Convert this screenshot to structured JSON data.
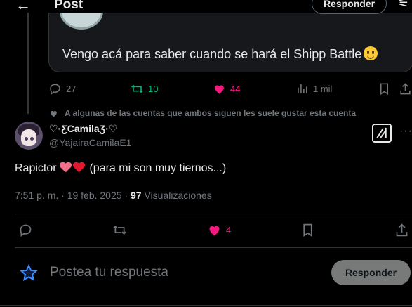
{
  "header": {
    "back_icon": "arrow-left-icon",
    "title": "Post",
    "reply_label": "Responder",
    "filter_icon": "sliders-icon"
  },
  "quoted": {
    "text": "Vengo acá para saber cuando se hará el Shipp Battle",
    "emoji": "smiling-face-emoji",
    "actions": {
      "replies": "27",
      "retweets": "10",
      "likes": "44",
      "views": "1 mil"
    }
  },
  "social_context": "A algunas de las cuentas que ambos siguen les suele gustar esta cuenta",
  "tweet": {
    "display_name": "♡·ƸCamilaƷ·♡",
    "handle": "@YajairaCamilaE1",
    "text": "Rapictor",
    "text_suffix": " (para mi son muy tiernos...)",
    "timestamp": "7:51 p. m. · 19 feb. 2025 · ",
    "views_count": "97",
    "views_label": " Visualizaciones",
    "likes": "4"
  },
  "composer": {
    "placeholder": "Postea tu respuesta",
    "button_label": "Responder"
  },
  "colors": {
    "background": "#000000",
    "text": "#e7e9ea",
    "muted": "#71767b",
    "retweet_green": "#00ba7c",
    "like_pink": "#f91880",
    "reply_button": "#787a7a"
  }
}
